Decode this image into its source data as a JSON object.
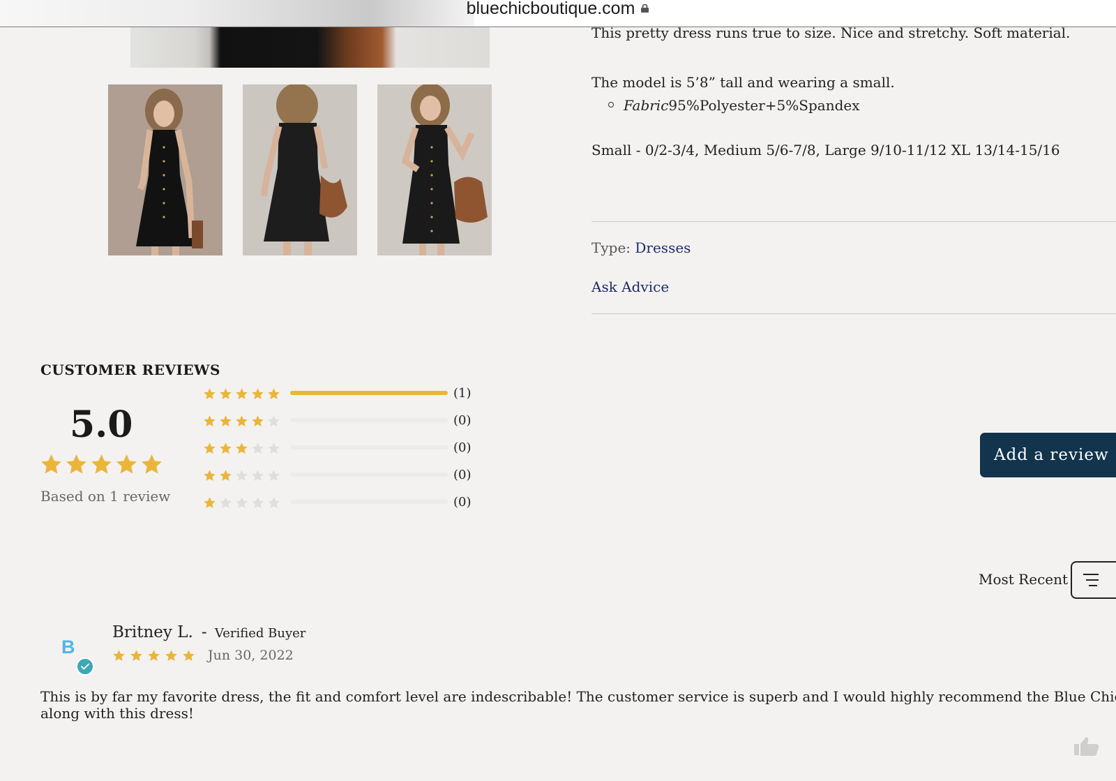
{
  "browser": {
    "url": "bluechicboutique.com"
  },
  "product": {
    "description": "This pretty dress runs true to size. Nice and stretchy. Soft material.",
    "model_note": "The model is 5’8” tall and wearing a small.",
    "fabric_label": "Fabric",
    "fabric_value": "95%Polyester+5%Spandex",
    "sizes": "Small - 0/2-3/4, Medium 5/6-7/8, Large 9/10-11/12 XL 13/14-15/16",
    "type_label": "Type:",
    "type_value": "Dresses",
    "ask_advice": "Ask Advice"
  },
  "reviews": {
    "title": "CUSTOMER REVIEWS",
    "average": "5.0",
    "average_stars": 5,
    "based_on": "Based on 1 review",
    "distribution": [
      {
        "stars": 5,
        "fraction": 1.0,
        "count": "(1)"
      },
      {
        "stars": 4,
        "fraction": 0.0,
        "count": "(0)"
      },
      {
        "stars": 3,
        "fraction": 0.0,
        "count": "(0)"
      },
      {
        "stars": 2,
        "fraction": 0.0,
        "count": "(0)"
      },
      {
        "stars": 1,
        "fraction": 0.0,
        "count": "(0)"
      }
    ],
    "add_review": "Add a review",
    "sort_label": "Most Recent",
    "items": [
      {
        "initial": "B",
        "name": "Britney L.",
        "separator": "-",
        "badge": "Verified Buyer",
        "stars": 5,
        "date": "Jun 30, 2022",
        "body": "This is by far my favorite dress, the fit and comfort level are indescribable! The customer service is superb and I would highly recommend the Blue Chic along with this dress!"
      }
    ]
  },
  "colors": {
    "star": "#eab53a",
    "star_empty": "#dedede",
    "link": "#1d2a6b",
    "button": "#12344d",
    "avatar_letter": "#4eb6e8",
    "check": "#3ea7b4"
  },
  "icons": [
    "lock-icon",
    "star-icon",
    "sort-icon",
    "check-icon",
    "thumbs-up-icon"
  ]
}
